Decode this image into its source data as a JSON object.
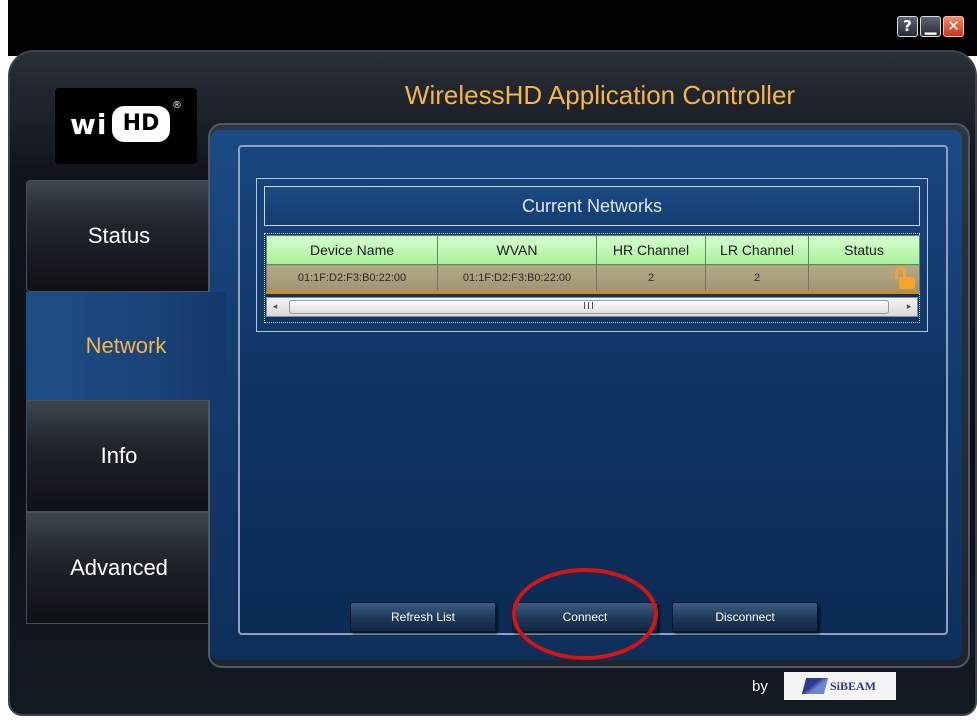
{
  "window": {
    "help_label": "?",
    "minimize_label": "▁",
    "close_label": "✕"
  },
  "logo": {
    "text_left": "wi",
    "text_badge": "HD",
    "reg": "®"
  },
  "app_title": "WirelessHD Application Controller",
  "nav": {
    "tabs": [
      {
        "label": "Status",
        "active": false
      },
      {
        "label": "Network",
        "active": true
      },
      {
        "label": "Info",
        "active": false
      },
      {
        "label": "Advanced",
        "active": false
      }
    ]
  },
  "networks": {
    "title": "Current Networks",
    "columns": [
      "Device Name",
      "WVAN",
      "HR Channel",
      "LR Channel",
      "Status"
    ],
    "rows": [
      {
        "device_name": "01:1F:D2:F3:B0:22:00",
        "wvan": "01:1F:D2:F3:B0:22:00",
        "hr_channel": "2",
        "lr_channel": "2",
        "status_icon": "unlocked-padlock-icon"
      }
    ],
    "scroll_left": "◂",
    "scroll_right": "▸",
    "scroll_grip": "III"
  },
  "actions": {
    "refresh_label": "Refresh List",
    "connect_label": "Connect",
    "disconnect_label": "Disconnect"
  },
  "footer": {
    "by_label": "by",
    "brand": "SiBEAM"
  },
  "colors": {
    "accent": "#f2b64a",
    "panel_blue": "#163f74",
    "header_green": "#b9f5ad",
    "highlight_red": "#d41515"
  }
}
